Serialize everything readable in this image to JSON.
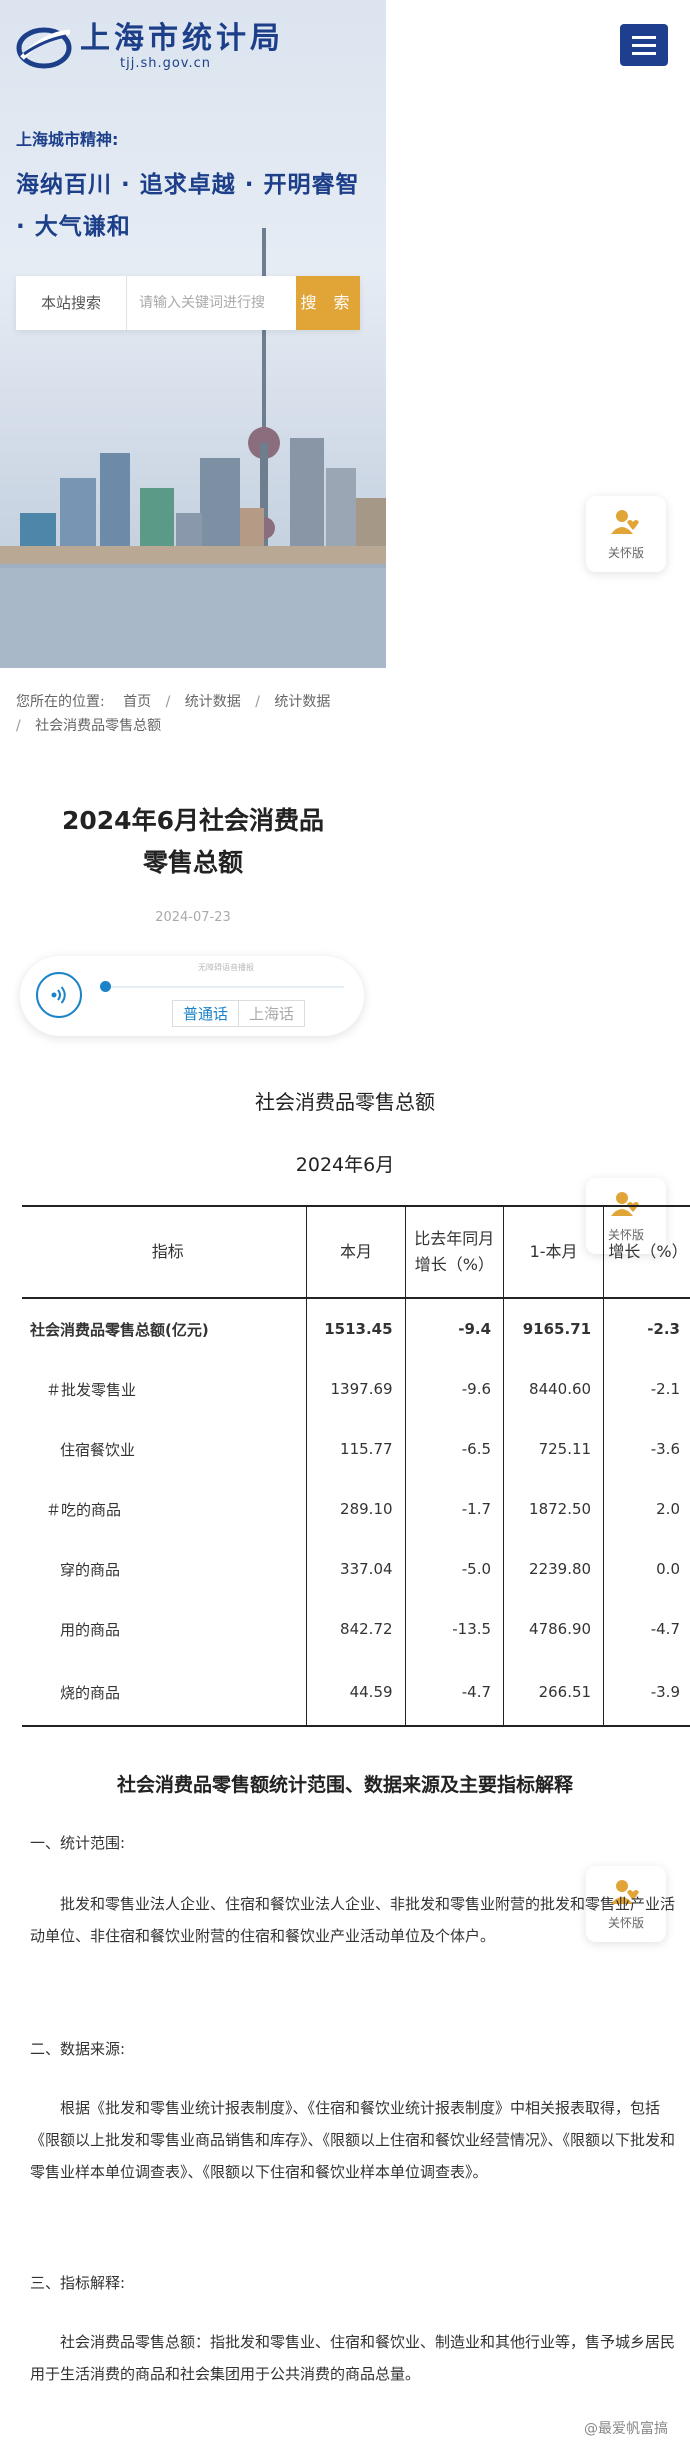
{
  "header": {
    "site_name": "上海市统计局",
    "site_domain": "tjj.sh.gov.cn"
  },
  "hero": {
    "spirit_title": "上海城市精神:",
    "spirit_text": "海纳百川 · 追求卓越 · 开明睿智 · 大气谦和"
  },
  "search": {
    "label": "本站搜索",
    "placeholder": "请输入关键词进行搜",
    "button": "搜 索"
  },
  "care_mode": {
    "label": "关怀版"
  },
  "breadcrumb": {
    "prefix": "您所在的位置:",
    "items": [
      "首页",
      "统计数据",
      "统计数据",
      "社会消费品零售总额"
    ]
  },
  "article": {
    "title_line1": "2024年6月社会消费品",
    "title_line2": "零售总额",
    "date": "2024-07-23"
  },
  "player": {
    "hint": "无障碍语音播报",
    "lang_active": "普通话",
    "lang_other": "上海话"
  },
  "table": {
    "title": "社会消费品零售总额",
    "subtitle": "2024年6月",
    "headers": [
      "指标",
      "本月",
      "比去年同月增长（%）",
      "1-本月",
      "增长（%）"
    ],
    "rows": [
      {
        "name": "社会消费品零售总额(亿元)",
        "month": "1513.45",
        "yoy": "-9.4",
        "ytd": "9165.71",
        "ytd_growth": "-2.3"
      },
      {
        "name": "＃批发零售业",
        "month": "1397.69",
        "yoy": "-9.6",
        "ytd": "8440.60",
        "ytd_growth": "-2.1"
      },
      {
        "name": "住宿餐饮业",
        "month": "115.77",
        "yoy": "-6.5",
        "ytd": "725.11",
        "ytd_growth": "-3.6"
      },
      {
        "name": "＃吃的商品",
        "month": "289.10",
        "yoy": "-1.7",
        "ytd": "1872.50",
        "ytd_growth": "2.0"
      },
      {
        "name": "穿的商品",
        "month": "337.04",
        "yoy": "-5.0",
        "ytd": "2239.80",
        "ytd_growth": "0.0"
      },
      {
        "name": "用的商品",
        "month": "842.72",
        "yoy": "-13.5",
        "ytd": "4786.90",
        "ytd_growth": "-4.7"
      },
      {
        "name": "烧的商品",
        "month": "44.59",
        "yoy": "-4.7",
        "ytd": "266.51",
        "ytd_growth": "-3.9"
      }
    ]
  },
  "explanation": {
    "title": "社会消费品零售额统计范围、数据来源及主要指标解释",
    "sec1_title": "一、统计范围:",
    "sec1_text": "批发和零售业法人企业、住宿和餐饮业法人企业、非批发和零售业附营的批发和零售业产业活动单位、非住宿和餐饮业附营的住宿和餐饮业产业活动单位及个体户。",
    "sec2_title": "二、数据来源:",
    "sec2_text": "根据《批发和零售业统计报表制度》、《住宿和餐饮业统计报表制度》中相关报表取得，包括《限额以上批发和零售业商品销售和库存》、《限额以上住宿和餐饮业经营情况》、《限额以下批发和零售业样本单位调查表》、《限额以下住宿和餐饮业样本单位调查表》。",
    "sec3_title": "三、指标解释:",
    "sec3_text": "社会消费品零售总额：指批发和零售业、住宿和餐饮业、制造业和其他行业等，售予城乡居民用于生活消费的商品和社会集团用于公共消费的商品总量。"
  },
  "watermark": "@最爱帆富搞"
}
